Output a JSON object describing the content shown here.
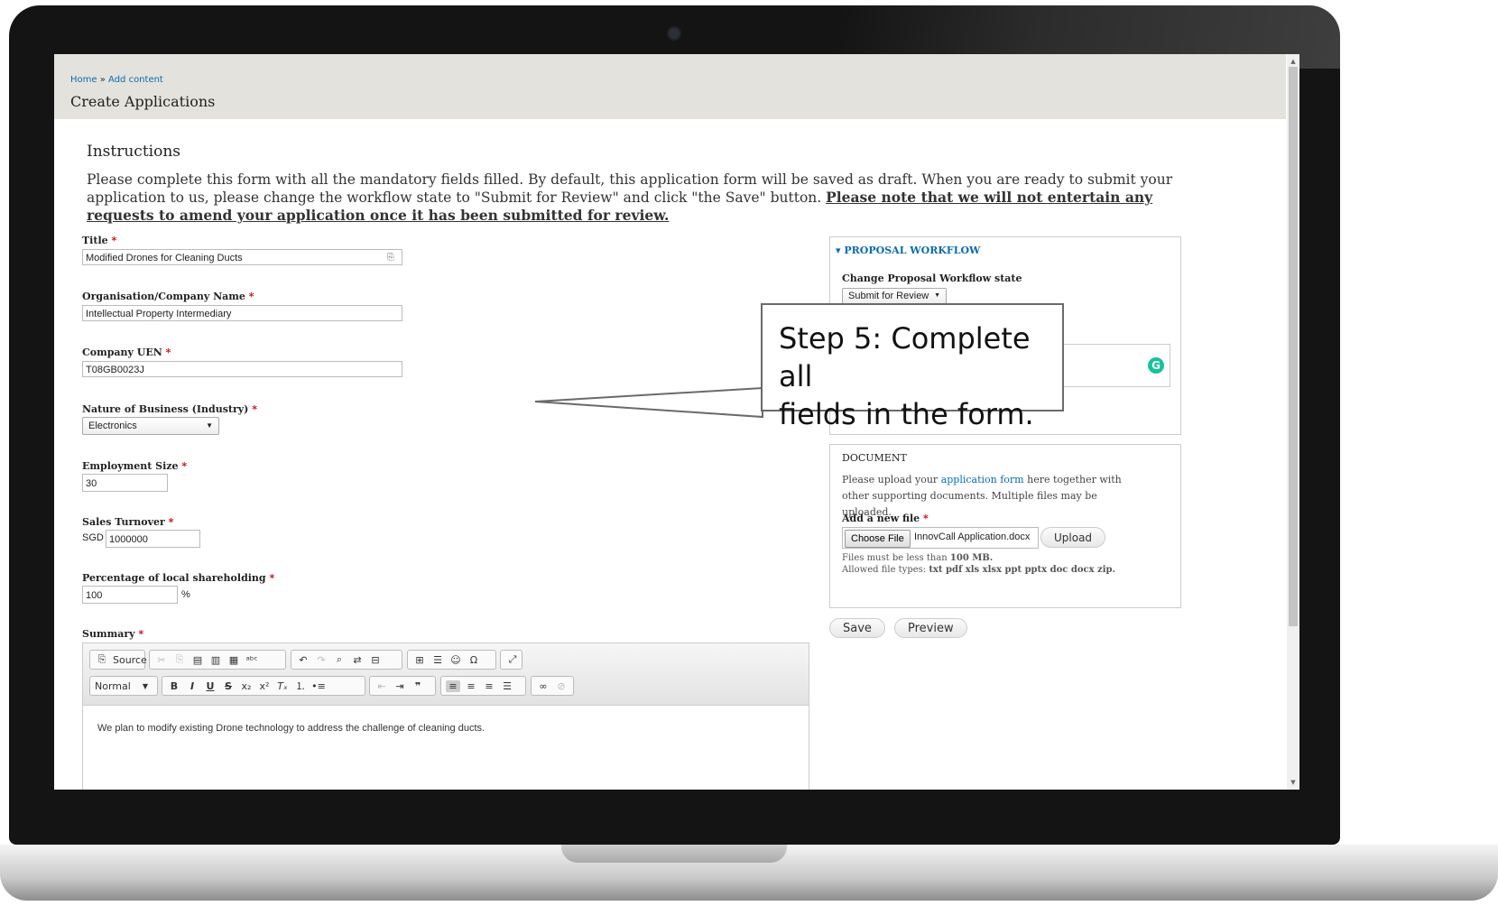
{
  "breadcrumb": {
    "home": "Home",
    "separator": "»",
    "current": "Add content"
  },
  "page_title": "Create Applications",
  "instructions": {
    "heading": "Instructions",
    "body": "Please complete this form with all the mandatory fields filled. By default, this application form will be saved as draft. When you are ready to submit your application to us, please change the workflow state to \"Submit for Review\" and click \"the Save\" button. ",
    "note": "Please note that we will not entertain any requests to amend your application once it has been submitted for review."
  },
  "form": {
    "title": {
      "label": "Title",
      "value": "Modified Drones for Cleaning Ducts"
    },
    "organisation": {
      "label": "Organisation/Company Name",
      "value": "Intellectual Property Intermediary"
    },
    "uen": {
      "label": "Company UEN",
      "value": "T08GB0023J"
    },
    "industry": {
      "label": "Nature of Business (Industry)",
      "value": "Electronics"
    },
    "employment": {
      "label": "Employment Size",
      "value": "30"
    },
    "turnover": {
      "label": "Sales Turnover",
      "currency": "SGD",
      "value": "1000000"
    },
    "shareholding": {
      "label": "Percentage of local shareholding",
      "value": "100",
      "unit": "%"
    },
    "summary": {
      "label": "Summary",
      "value": "We plan to modify existing Drone technology to address the challenge of cleaning ducts."
    },
    "required_mark": "*"
  },
  "toolbar": {
    "source": "Source",
    "format": "Normal",
    "icons": [
      "cut-icon",
      "copy-icon",
      "paste-icon",
      "paste-text-icon",
      "paste-word-icon",
      "spellcheck-icon",
      "undo-icon",
      "redo-icon",
      "find-icon",
      "replace-icon",
      "page-break-icon",
      "table-icon",
      "horizontal-rule-icon",
      "smiley-icon",
      "special-char-icon",
      "maximize-icon",
      "bold-icon",
      "italic-icon",
      "underline-icon",
      "strike-icon",
      "subscript-icon",
      "superscript-icon",
      "remove-format-icon",
      "numbered-list-icon",
      "bullet-list-icon",
      "outdent-icon",
      "indent-icon",
      "blockquote-icon",
      "align-left-icon",
      "align-center-icon",
      "align-right-icon",
      "justify-icon",
      "link-icon",
      "unlink-icon"
    ]
  },
  "workflow": {
    "legend": "PROPOSAL WORKFLOW",
    "state_label": "Change Proposal Workflow state",
    "state_value": "Submit for Review"
  },
  "document": {
    "heading": "DOCUMENT",
    "text_before": "Please upload your ",
    "link": "application form",
    "text_after": " here together with other supporting documents. Multiple files may be uploaded.",
    "add_label": "Add a new file",
    "choose_button": "Choose File",
    "file_name": "InnovCall Application.docx",
    "upload_button": "Upload",
    "limit_prefix": "Files must be less than ",
    "limit_value": "100 MB.",
    "types_prefix": "Allowed file types: ",
    "types_value": "txt pdf xls xlsx ppt pptx doc docx zip."
  },
  "actions": {
    "save": "Save",
    "preview": "Preview"
  },
  "callout": {
    "line1": "Step 5: Complete all",
    "line2": "fields in the form."
  },
  "colors": {
    "link": "#0b6ab0",
    "required": "#cc0000",
    "header_bg": "#e4e2dc",
    "grammarly": "#15c39a"
  }
}
